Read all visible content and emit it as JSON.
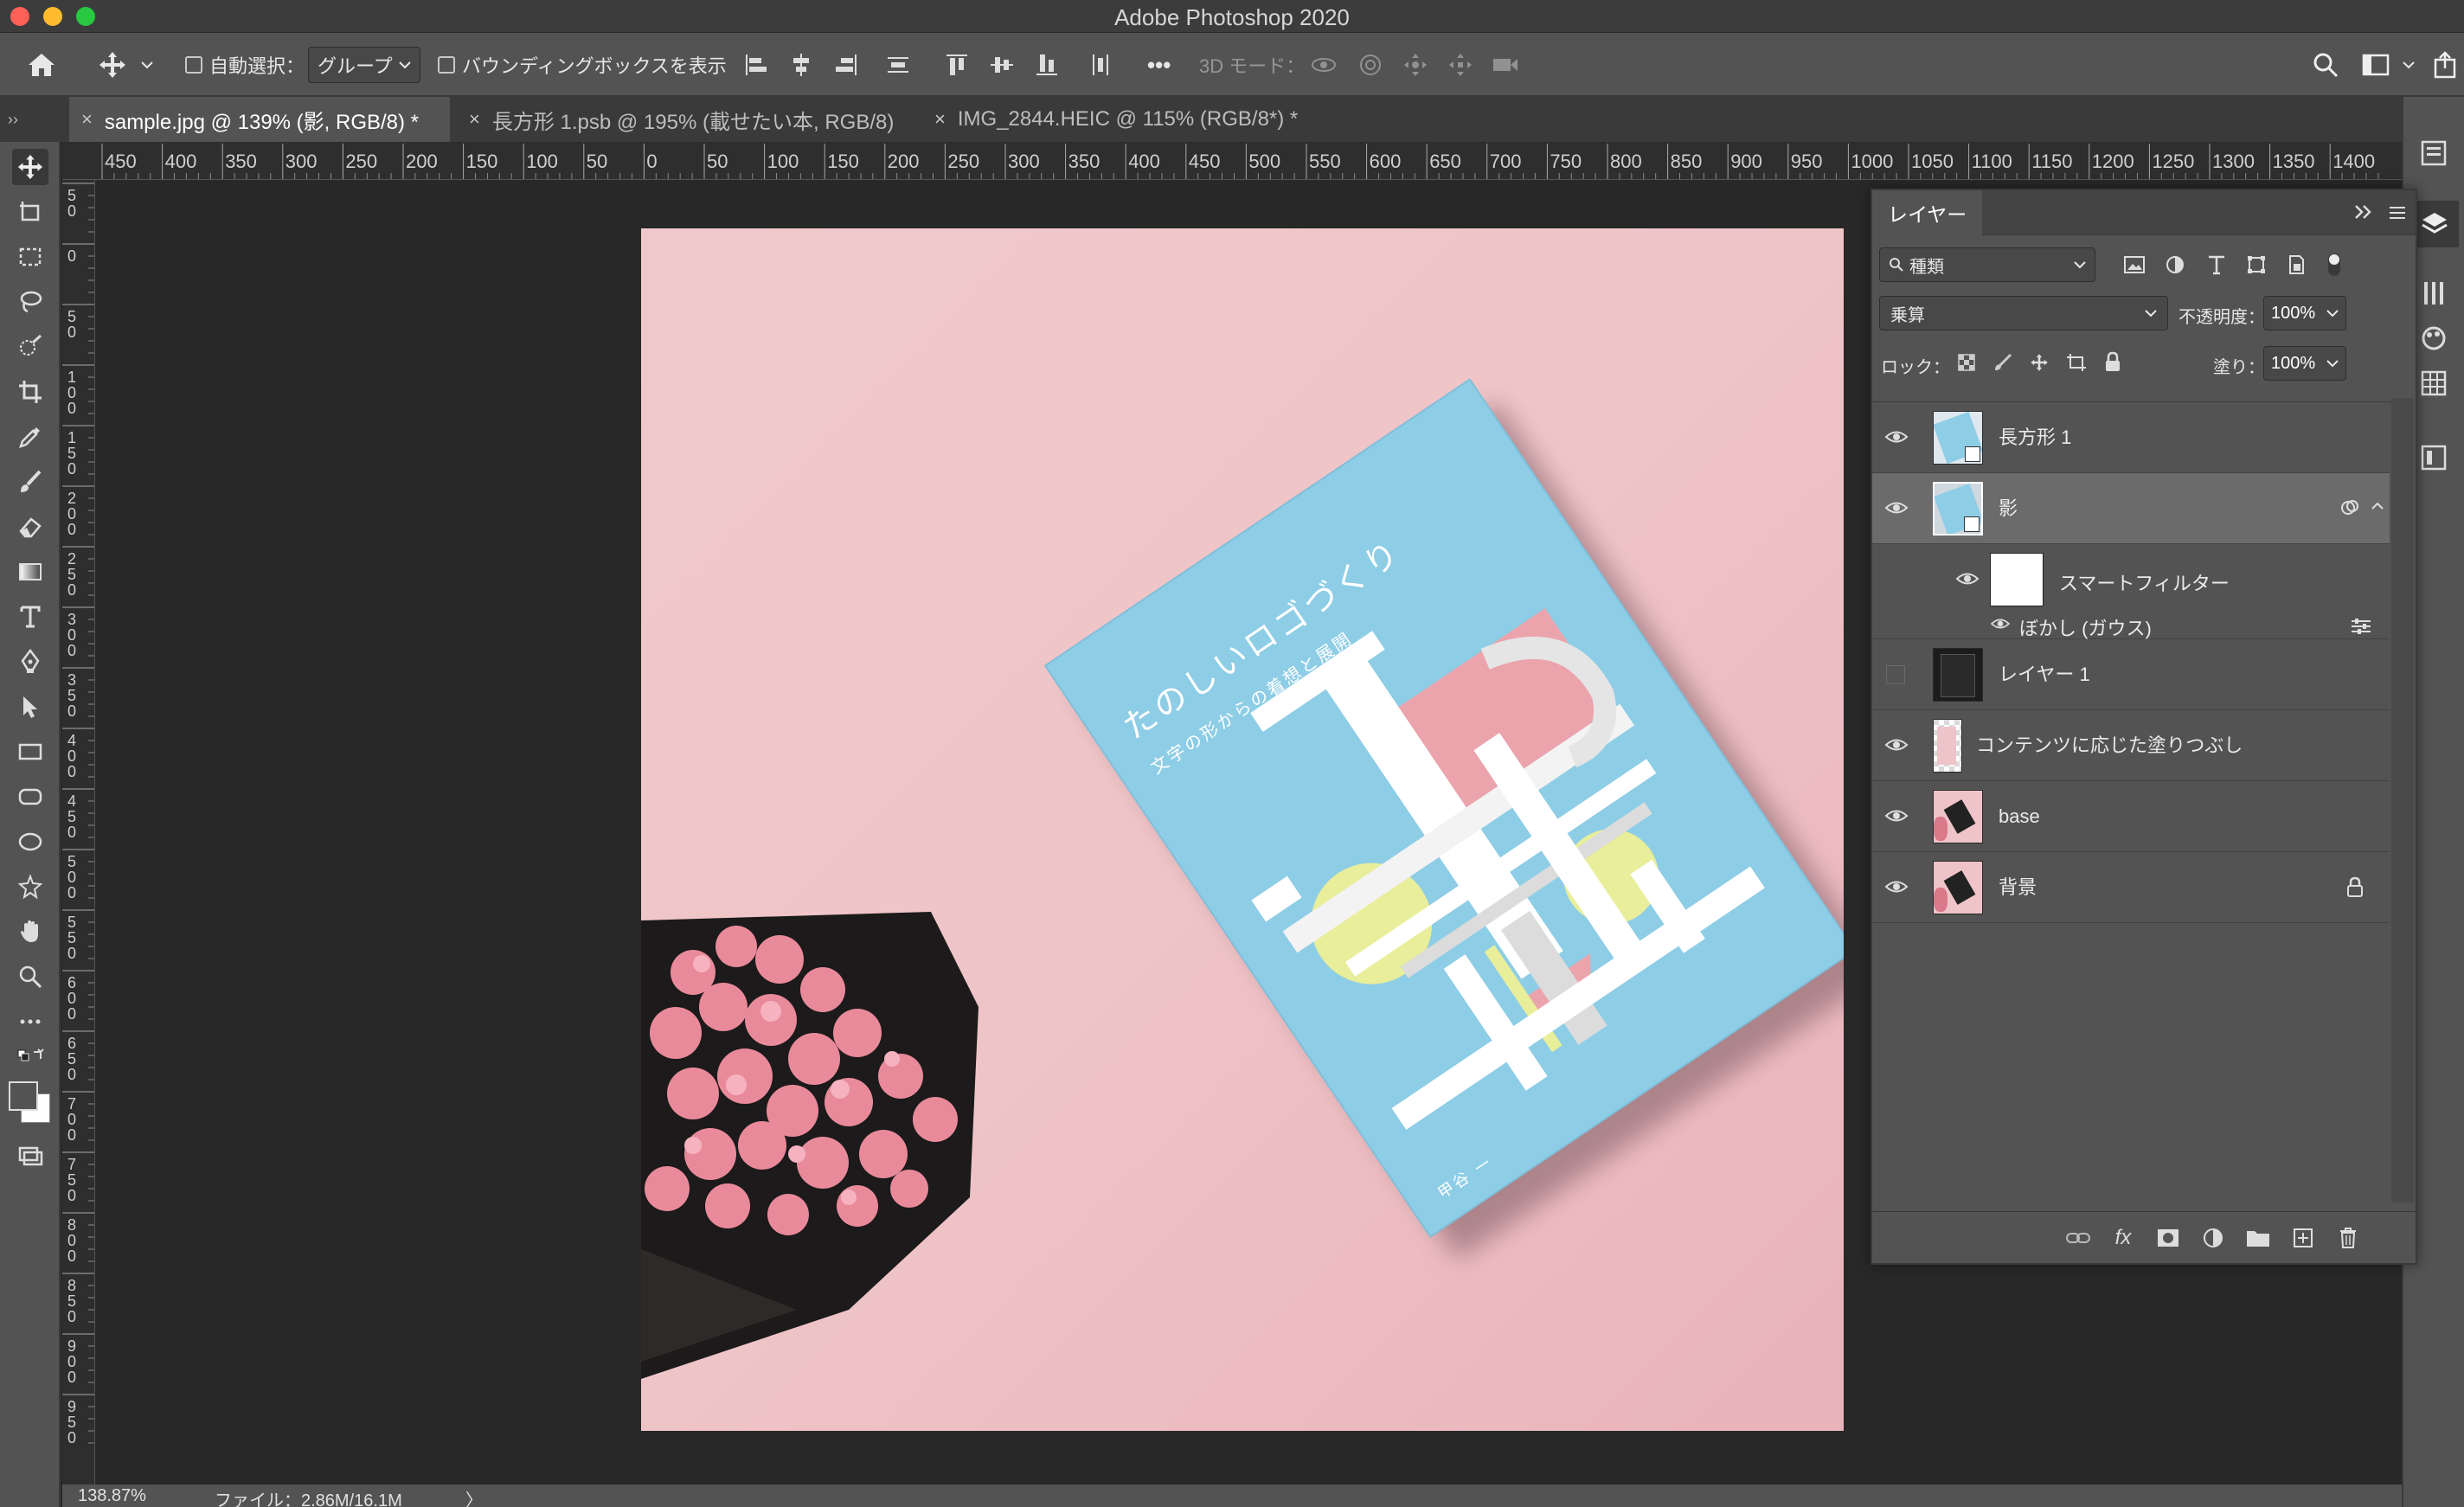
{
  "app": {
    "title": "Adobe Photoshop 2020"
  },
  "options_bar": {
    "auto_select_label": "自動選択：",
    "auto_select_target": "グループ",
    "bounding_box_label": "バウンディングボックスを表示",
    "more_label": "•••",
    "mode_3d_label": "3D モード："
  },
  "tabs": [
    {
      "label": "sample.jpg @ 139% (影, RGB/8) *",
      "close": "×"
    },
    {
      "label": "長方形 1.psb @ 195% (載せたい本, RGB/8)",
      "close": "×"
    },
    {
      "label": "IMG_2844.HEIC @ 115% (RGB/8*) *",
      "close": "×"
    }
  ],
  "panel_collapse_glyph": "››",
  "ruler": {
    "h_labels": [
      "450",
      "400",
      "350",
      "300",
      "250",
      "200",
      "150",
      "100",
      "50",
      "0",
      "50",
      "100",
      "150",
      "200",
      "250",
      "300",
      "350",
      "400",
      "450",
      "500",
      "550",
      "600",
      "650",
      "700",
      "750",
      "800",
      "850",
      "900",
      "950",
      "1000",
      "1050",
      "1100",
      "1150",
      "1200",
      "1250",
      "1300",
      "1350",
      "1400"
    ],
    "v_labels": [
      "50",
      "0",
      "50",
      "100",
      "150",
      "200",
      "250",
      "300",
      "350",
      "400",
      "450",
      "500",
      "550",
      "600",
      "650",
      "700",
      "750",
      "800",
      "850",
      "900",
      "950"
    ]
  },
  "document": {
    "book_title": "たのしいロゴづくり",
    "book_subtitle": "文字の形からの着想と展開",
    "book_author": "甲谷 一"
  },
  "status": {
    "zoom": "138.87%",
    "file_info": "ファイル：2.86M/16.1M",
    "arrow": "〉"
  },
  "layers_panel": {
    "tab_label": "レイヤー",
    "filter_label": "種類",
    "blend_mode": "乗算",
    "opacity_label": "不透明度：",
    "opacity_value": "100%",
    "lock_label": "ロック：",
    "fill_label": "塗り：",
    "fill_value": "100%",
    "layers": [
      {
        "name": "長方形 1"
      },
      {
        "name": "影"
      },
      {
        "name": "レイヤー 1"
      },
      {
        "name": "コンテンツに応じた塗りつぶし"
      },
      {
        "name": "base"
      },
      {
        "name": "背景"
      }
    ],
    "smart_filter_label": "スマートフィルター",
    "blur_label": "ぼかし (ガウス)",
    "footer_fx": "fx"
  },
  "colors": {
    "ui_panel": "#535353",
    "ui_dark": "#282828",
    "canvas_pink": "#eec4c8",
    "book_blue": "#8ecde6",
    "traffic_red": "#fe5f57",
    "traffic_yellow": "#febc2e",
    "traffic_green": "#28c840"
  }
}
